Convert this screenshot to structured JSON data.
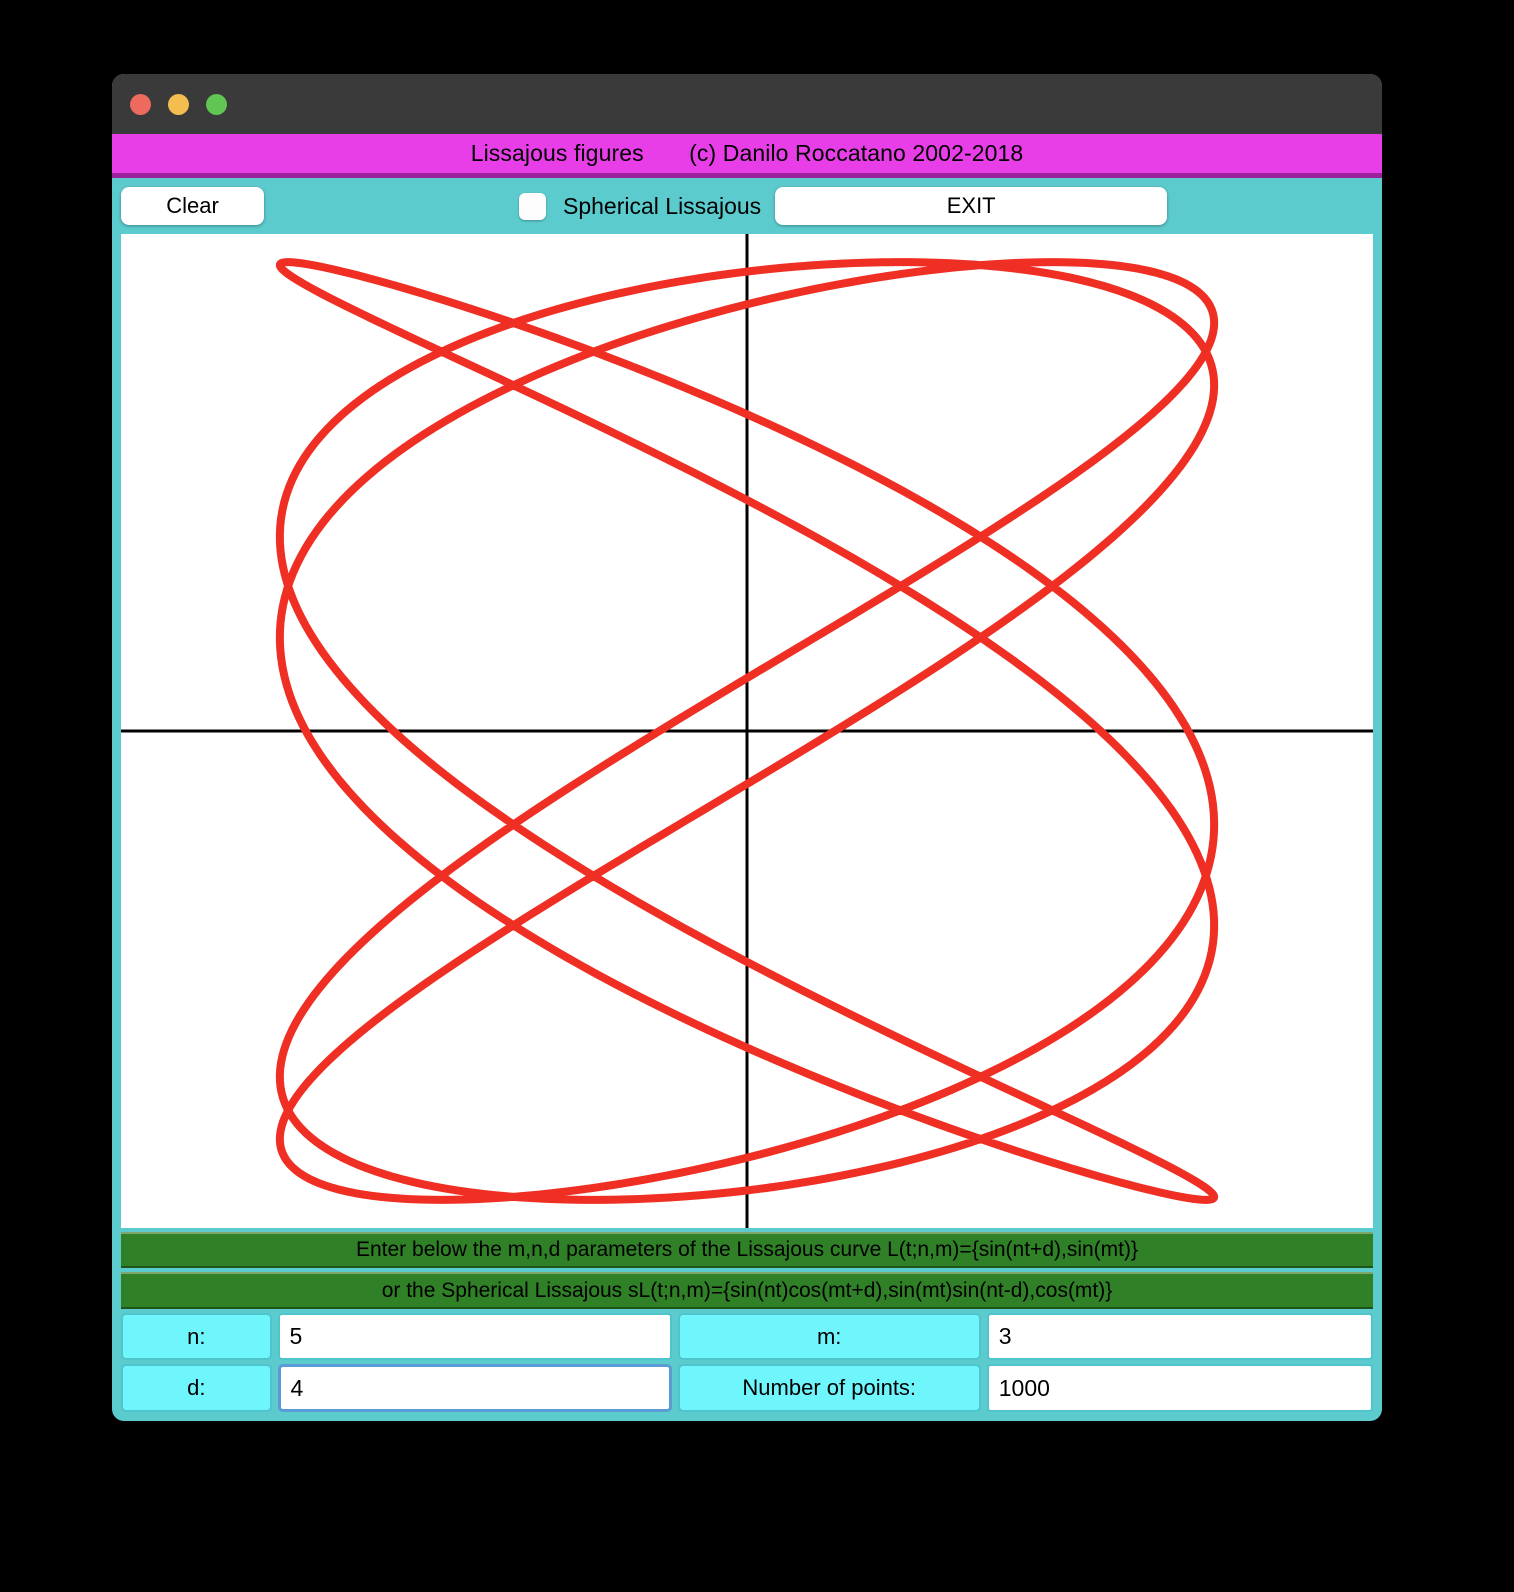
{
  "window": {
    "traffic_lights": [
      "close",
      "minimize",
      "maximize"
    ]
  },
  "banner": {
    "text": "Lissajous figures       (c) Danilo Roccatano 2002-2018",
    "background_color": "#e83ee8",
    "border_color": "#9c219c"
  },
  "toolbar": {
    "clear_label": "Clear",
    "spherical_label": "Spherical Lissajous",
    "spherical_checked": false,
    "exit_label": "EXIT",
    "background_color": "#5ccbce"
  },
  "instructions": {
    "line1": "Enter below the m,n,d parameters of the Lissajous curve L(t;n,m)={sin(nt+d),sin(mt)}",
    "line2": "or the Spherical Lissajous  sL(t;n,m)={sin(nt)cos(mt+d),sin(mt)sin(nt-d),cos(mt)}",
    "background_color": "#2f8026"
  },
  "parameters": {
    "n_label": "n:",
    "n_value": "5",
    "m_label": "m:",
    "m_value": "3",
    "d_label": "d:",
    "d_value": "4",
    "points_label": "Number of points:",
    "points_value": "1000",
    "label_color": "#6ff5fc",
    "focus_color": "#5b9bd5"
  },
  "chart_data": {
    "type": "line",
    "title": "",
    "xlabel": "",
    "ylabel": "",
    "curve_color": "#ef2f23",
    "axis_color": "#000000",
    "background_color": "#ffffff",
    "grid": false,
    "legend": "none",
    "equation": "L(t;n,m)={sin(nt+d),sin(mt)}",
    "n": 5,
    "m": 3,
    "d": 4,
    "num_points": 1000,
    "x_axis_at_y": 0,
    "y_axis_at_x": 0,
    "xlim": [
      -1.34,
      1.34
    ],
    "ylim": [
      -1.06,
      1.06
    ],
    "t_range": [
      0,
      6.283185307179586
    ],
    "line_width": 4
  }
}
